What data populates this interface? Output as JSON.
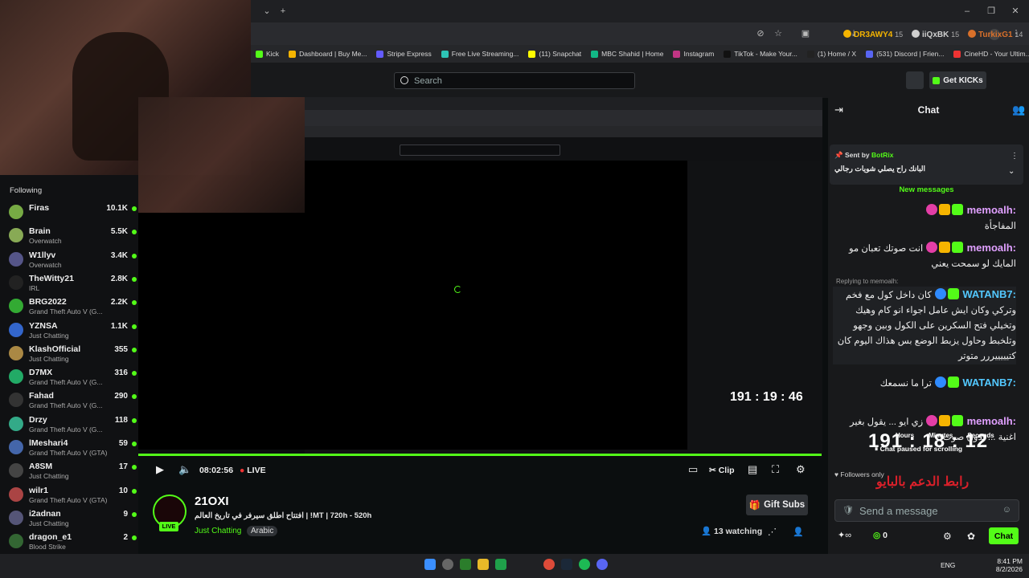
{
  "browser": {
    "bookmarks": [
      "Kick",
      "Dashboard | Buy Me...",
      "Stripe Express",
      "Free Live Streaming...",
      "(11) Snapchat",
      "MBC Shahid | Home",
      "Instagram",
      "TikTok - Make Your...",
      "(1) Home / X",
      "(531) Discord | Frien...",
      "CineHD - Your Ultim..."
    ]
  },
  "header": {
    "search_placeholder": "Search",
    "get_kicks": "Get KICKs"
  },
  "sidebar": {
    "title": "Following",
    "items": [
      {
        "name": "Firas",
        "category": "",
        "viewers": "10.1K"
      },
      {
        "name": "Brain",
        "category": "Overwatch",
        "viewers": "5.5K"
      },
      {
        "name": "W1llyv",
        "category": "Overwatch",
        "viewers": "3.4K"
      },
      {
        "name": "TheWitty21",
        "category": "IRL",
        "viewers": "2.8K"
      },
      {
        "name": "BRG2022",
        "category": "Grand Theft Auto V (G...",
        "viewers": "2.2K"
      },
      {
        "name": "YZNSA",
        "category": "Just Chatting",
        "viewers": "1.1K"
      },
      {
        "name": "KlashOfficial",
        "category": "Just Chatting",
        "viewers": "355"
      },
      {
        "name": "D7MX",
        "category": "Grand Theft Auto V (G...",
        "viewers": "316"
      },
      {
        "name": "Fahad",
        "category": "Grand Theft Auto V (G...",
        "viewers": "290"
      },
      {
        "name": "Drzy",
        "category": "Grand Theft Auto V (G...",
        "viewers": "118"
      },
      {
        "name": "lMeshari4",
        "category": "Grand Theft Auto V (GTA)",
        "viewers": "59"
      },
      {
        "name": "A8SM",
        "category": "Just Chatting",
        "viewers": "17"
      },
      {
        "name": "wilr1",
        "category": "Grand Theft Auto V (GTA)",
        "viewers": "10"
      },
      {
        "name": "i2adnan",
        "category": "Just Chatting",
        "viewers": "9"
      },
      {
        "name": "dragon_e1",
        "category": "Blood Strike",
        "viewers": "2"
      }
    ]
  },
  "player": {
    "elapsed": "08:02:56",
    "live": "LIVE",
    "clip": "Clip",
    "progress": 1.0
  },
  "stream": {
    "channel": "21OXI",
    "title": "افتتاح اطلق سيرفر في تاريخ العالم | !MT | 720h - 520h",
    "category": "Just Chatting",
    "language": "Arabic",
    "gift_subs": "Gift Subs",
    "watching_count": "13",
    "watching_label": "watching",
    "live_badge": "LIVE"
  },
  "chat": {
    "title": "Chat",
    "gifters": [
      {
        "name": "DR3AWY4",
        "count": "15",
        "color": "#f5b400"
      },
      {
        "name": "iiQxBK",
        "count": "15",
        "color": "#cfcfcf"
      },
      {
        "name": "TurkixG1",
        "count": "14",
        "color": "#d9702a"
      }
    ],
    "pinned": {
      "label": "Sent by",
      "user": "BotRix",
      "text": "البانك راح يصلي شويات رجالي"
    },
    "new_messages": "New messages",
    "messages": [
      {
        "user": "memoalh:",
        "badge": "27",
        "text": "المفاجأة"
      },
      {
        "user": "memoalh:",
        "badge": "27",
        "text": "انت صوتك تعبان مو المايك لو سمحت يعني"
      },
      {
        "user": "WATANB7:",
        "badge": "37",
        "text": "كان داخل كول مع فخم وتركي وكان ايش عامل اجواء انو كام وهيك وتخيلي فتح السكرين على الكول وبين وجهو وتلخبط وحاول يزبط الوضع بس هذاك اليوم كان كتيييييررر متوتر"
      },
      {
        "user": "WATANB7:",
        "badge": "37",
        "text": "ترا ما نسمعك"
      },
      {
        "user": "memoalh:",
        "badge": "27",
        "text": "زي ايو ... يقول بغير اغنية ... بدون صوت"
      }
    ],
    "reply_hint": "Replying to memoalh:",
    "followers_only": "Followers only",
    "timer": "191 : 18 : 12",
    "timer_small": "191 : 19 : 46",
    "timer_labels": [
      "Hours",
      "Minutes",
      "Seconds"
    ],
    "chat_paused": "Chat paused for scrolling",
    "promo": "رابط الدعم بالبايو",
    "send_placeholder": "Send a message",
    "points": "0",
    "chat_button": "Chat"
  },
  "taskbar": {
    "lang": "ENG",
    "time": "8:41 PM",
    "date": "8/2/2026"
  },
  "colors": {
    "accent": "#53fc18",
    "bg": "#0b0e0f",
    "panel": "#18191b"
  }
}
